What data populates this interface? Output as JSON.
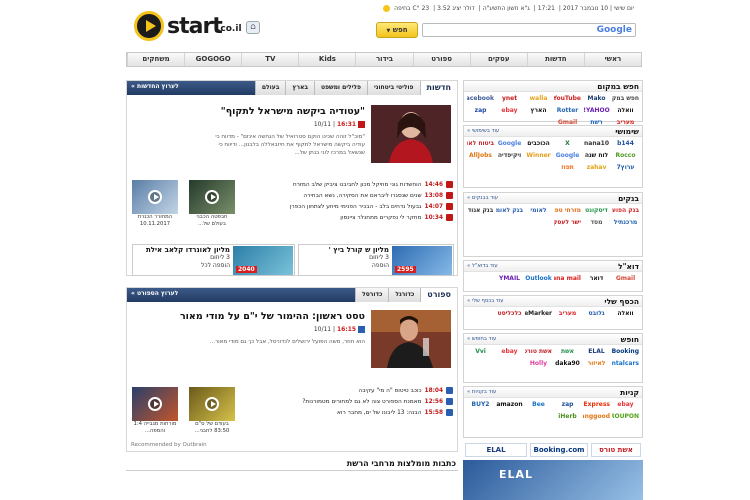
{
  "header": {
    "logo_word": "start",
    "logo_tld": ".co.il",
    "home_icon": "home-icon",
    "status": {
      "temperature": "23 °C בחיפה",
      "dollar": "דולר יציג 3.52",
      "hebrew_date": "ג\"א חשון התשע\"ה",
      "time": "17:21",
      "gregorian_date": "יום שישי | 10 נובמבר 2017"
    },
    "search": {
      "button_label": "חפש",
      "engine_label": "Google"
    }
  },
  "nav": [
    "ראשי",
    "חדשות",
    "עסקים",
    "ספורט",
    "בידור",
    "Kids",
    "TV",
    "GOGOGO",
    "משחקים"
  ],
  "news": {
    "head_link": "לערוץ החדשות »",
    "tabs": [
      "חדשות",
      "פוליטי ביטחוני",
      "פלילים ומשפט",
      "בארץ",
      "בעולם"
    ],
    "headline": "\"עטודיה ביקשה מישראל לתקוף\"",
    "time": "16:31",
    "date": "10/11",
    "summary": "\"מוכ\"ל זוהה שכינו הוקם סטרואיל של הנחשה אינזם\" - מדווח כי עודיה ביקשה מישראל לתקוף את חיזבאללה בלבנון... ודיווח כי שנשאל במרכז לוני בנתן של...",
    "items": [
      {
        "time": "14:46",
        "text": "הוחשדות גוני מוזיקל מכון לחביבנו ציביק שלב המזרח"
      },
      {
        "time": "13:08",
        "text": "שנים שנסגרו ליבראם את הסקירה, נשא הבחירה"
      },
      {
        "time": "14:07",
        "text": "גבעול נדחים בלב - הבכיר הפנימי מיוזע לצתחון הכפרן"
      },
      {
        "time": "10:34",
        "text": "מחקר לי נפקרים מתחנלר ציינסון"
      }
    ],
    "videos": [
      {
        "caption": "חבפטה הכבני בעולם של..."
      },
      {
        "caption": "המחורר הכנרת 10.11.2017"
      }
    ],
    "lotto": [
      {
        "title": "מליון ש קורל ביץ '",
        "line1": "3 ליוזום",
        "line2": "הוספה",
        "num": "2595"
      },
      {
        "title": "מליון לאונרדו קלאב אילת",
        "line1": "3 ליוזום",
        "line2": "הוספה לכל",
        "num": "2040"
      }
    ]
  },
  "sport": {
    "head_link": "לערוץ הספורט »",
    "tabs": [
      "ספורט",
      "כדורגל",
      "כדורסל"
    ],
    "headline": "טסט ראשון: ההימור של י\"ם על מודי מאור",
    "time": "16:15",
    "date": "10/11",
    "summary": "הוא חוזר, משה הפועל ירושלים לכדורסל, אבל כך גם מודי מאור...",
    "items": [
      {
        "time": "18:04",
        "text": "כוכב טיטוס \"ה מי\" עקיבה"
      },
      {
        "time": "12:56",
        "text": "מאמנת הספורט צוה לא גם למחורים מטמורנות?"
      },
      {
        "time": "15:58",
        "text": "הבנה: 13 ליבונו של ים, מחבר רוא"
      }
    ],
    "videos": [
      {
        "caption": "בעודם של ס\"ם 83:50 לחבני..."
      },
      {
        "caption": "מורחות מגבייה 1:4 והמפה..."
      }
    ]
  },
  "recommended": {
    "title": "כתבות מומלצות מרחבי הרשת",
    "outbrain": "Recommended by Outbrain"
  },
  "right": {
    "boxes": [
      {
        "title": "חפש במקום",
        "more": "",
        "chips": [
          {
            "label": "חפש במקום",
            "color": "#444"
          },
          {
            "label": "Mako",
            "color": "#1c3e73"
          },
          {
            "label": "YouTube",
            "color": "#d32020"
          },
          {
            "label": "walla",
            "color": "#e8a11c"
          },
          {
            "label": "ynet",
            "color": "#c61818"
          },
          {
            "label": "facebook",
            "color": "#3b5998"
          },
          {
            "label": "וואלה",
            "color": "#111"
          },
          {
            "label": "YAHOO!",
            "color": "#6b1fb2"
          },
          {
            "label": "Rotter",
            "color": "#2567b3"
          },
          {
            "label": "הארץ",
            "color": "#111"
          },
          {
            "label": "ebay",
            "color": "#e53238"
          },
          {
            "label": "zap",
            "color": "#1d4b9c"
          },
          {
            "label": "מעריב",
            "color": "#d91d1d"
          },
          {
            "label": "רשת",
            "color": "#1f65c7"
          },
          {
            "label": "Gmail",
            "color": "#d14836"
          }
        ]
      },
      {
        "title": "שימושי",
        "more": "עוד בשימושי »",
        "chips": [
          {
            "label": "b144",
            "color": "#1f4d9c"
          },
          {
            "label": "nana10",
            "color": "#333"
          },
          {
            "label": "X",
            "color": "#1d7a3a"
          },
          {
            "label": "הכוכבים",
            "color": "#111"
          },
          {
            "label": "Google",
            "color": "#4a7fe0"
          },
          {
            "label": "ביטוח לאומי",
            "color": "#c41f24"
          },
          {
            "label": "Rocco",
            "color": "#4f9a28"
          },
          {
            "label": "לוח שנה",
            "color": "#111"
          },
          {
            "label": "Google",
            "color": "#4a7fe0"
          },
          {
            "label": "Winner",
            "color": "#e59d1b"
          },
          {
            "label": "ויקיפדיה",
            "color": "#333"
          },
          {
            "label": "AllJobs",
            "color": "#e07612"
          },
          {
            "label": "ערוץ7",
            "color": "#1b5aa6"
          },
          {
            "label": "zahav",
            "color": "#e2a312"
          },
          {
            "label": "תפוז",
            "color": "#f06a12"
          }
        ]
      },
      {
        "title": "בנקים",
        "more": "עוד בבנקים »",
        "chips": [
          {
            "label": "בנק הפועלים",
            "color": "#cf1e1e"
          },
          {
            "label": "דיסקונט",
            "color": "#1e8f46"
          },
          {
            "label": "מזרחי טפחות",
            "color": "#e06b12"
          },
          {
            "label": "לאומי",
            "color": "#2a5eb0"
          },
          {
            "label": "בנק לאומי",
            "color": "#2a5eb0"
          },
          {
            "label": "בנק אגוד",
            "color": "#333"
          },
          {
            "label": "מרכנתיל",
            "color": "#1e5fae"
          },
          {
            "label": "מסד",
            "color": "#555"
          },
          {
            "label": "ישר לעסק",
            "color": "#c41f24"
          }
        ]
      },
      {
        "title": "דוא\"ל",
        "more": "עוד בדוא\"ל »",
        "chips": [
          {
            "label": "Gmail",
            "color": "#d14836"
          },
          {
            "label": "דואר",
            "color": "#111"
          },
          {
            "label": "nana mail",
            "color": "#d91d1d"
          },
          {
            "label": "Outlook",
            "color": "#1a72c9"
          },
          {
            "label": "YMAIL",
            "color": "#6b1fb2"
          }
        ]
      },
      {
        "title": "הכסף שלי",
        "more": "עוד בכסף שלי »",
        "chips": [
          {
            "label": "וואלה",
            "color": "#111"
          },
          {
            "label": "גלובס",
            "color": "#1e5fae"
          },
          {
            "label": "מעריב",
            "color": "#d91d1d"
          },
          {
            "label": "TheMarker",
            "color": "#222"
          },
          {
            "label": "כלכליסט",
            "color": "#c41f24"
          }
        ]
      },
      {
        "title": "חופש",
        "more": "עוד בחופש »",
        "chips": [
          {
            "label": "Booking",
            "color": "#003580"
          },
          {
            "label": "ELAL",
            "color": "#1b3a7a"
          },
          {
            "label": "אשת",
            "color": "#1e8f46"
          },
          {
            "label": "אשת טורס",
            "color": "#c41f24"
          },
          {
            "label": "ebay",
            "color": "#e53238"
          },
          {
            "label": "Vvi",
            "color": "#1e8f46"
          },
          {
            "label": "rentalcars",
            "color": "#1a72c9"
          },
          {
            "label": "לאיזור",
            "color": "#e07612"
          },
          {
            "label": "daka90",
            "color": "#111"
          },
          {
            "label": "Holly",
            "color": "#e03a9a"
          }
        ]
      },
      {
        "title": "קניות",
        "more": "עוד בקניות »",
        "chips": [
          {
            "label": "ebay",
            "color": "#e53238"
          },
          {
            "label": "AliExpress",
            "color": "#e62e04"
          },
          {
            "label": "zap",
            "color": "#1d4b9c"
          },
          {
            "label": "Bee",
            "color": "#1a72c9"
          },
          {
            "label": "amazon",
            "color": "#111"
          },
          {
            "label": "BUY2",
            "color": "#1e5fae"
          },
          {
            "label": "GROUPON",
            "color": "#53a318"
          },
          {
            "label": "Banggood",
            "color": "#e07612"
          },
          {
            "label": "iHerb",
            "color": "#4a8f1a"
          }
        ]
      }
    ],
    "bottom_banners": [
      "אשת טורס",
      "Booking.com",
      "ELAL"
    ],
    "big_banner": "ELAL"
  }
}
